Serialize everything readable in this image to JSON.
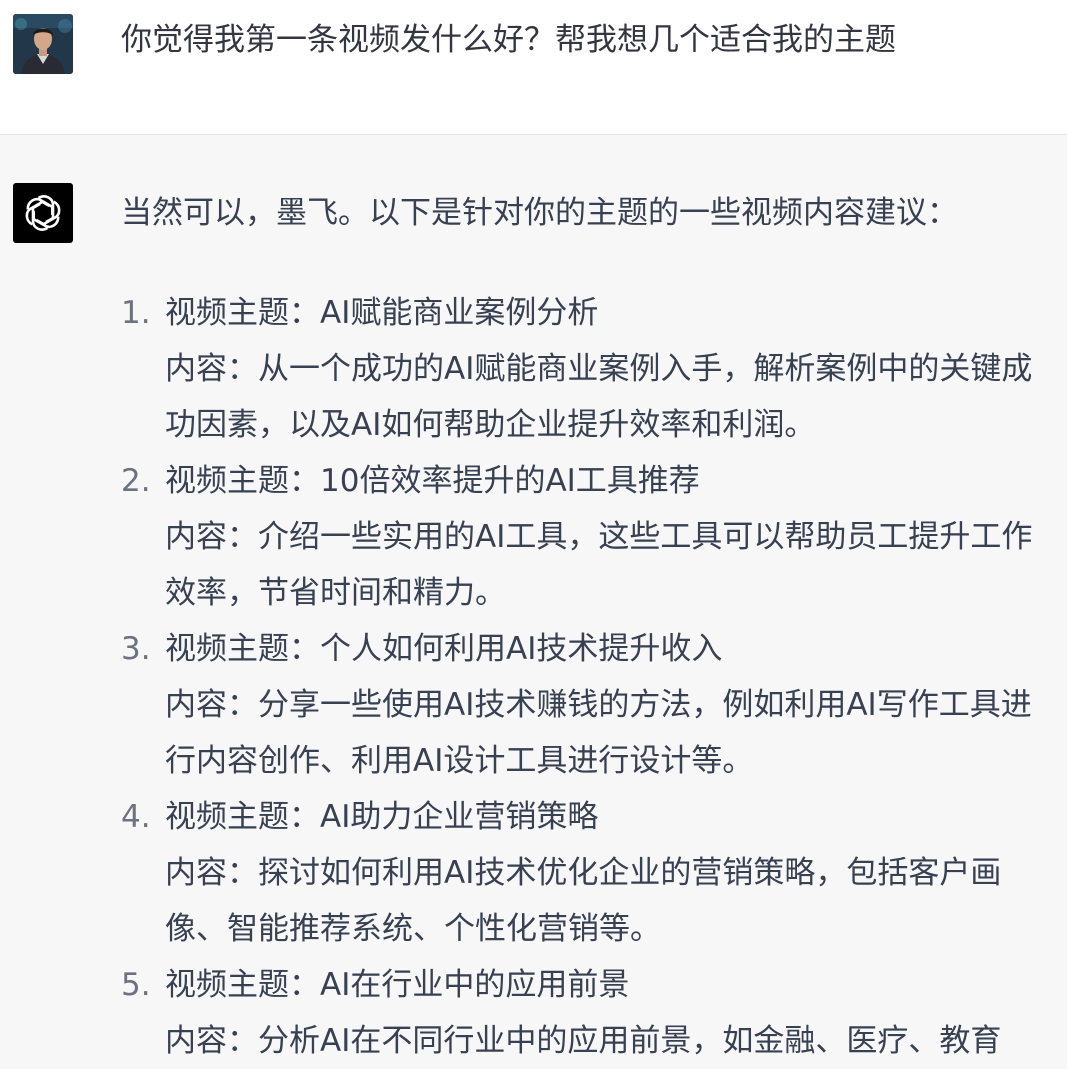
{
  "user": {
    "message": "你觉得我第一条视频发什么好？帮我想几个适合我的主题"
  },
  "assistant": {
    "intro": "当然可以，墨飞。以下是针对你的主题的一些视频内容建议：",
    "items": [
      {
        "number": "1.",
        "title": "视频主题：AI赋能商业案例分析",
        "content": "内容：从一个成功的AI赋能商业案例入手，解析案例中的关键成功因素，以及AI如何帮助企业提升效率和利润。"
      },
      {
        "number": "2.",
        "title": "视频主题：10倍效率提升的AI工具推荐",
        "content": "内容：介绍一些实用的AI工具，这些工具可以帮助员工提升工作效率，节省时间和精力。"
      },
      {
        "number": "3.",
        "title": "视频主题：个人如何利用AI技术提升收入",
        "content": "内容：分享一些使用AI技术赚钱的方法，例如利用AI写作工具进行内容创作、利用AI设计工具进行设计等。"
      },
      {
        "number": "4.",
        "title": "视频主题：AI助力企业营销策略",
        "content": "内容：探讨如何利用AI技术优化企业的营销策略，包括客户画像、智能推荐系统、个性化营销等。"
      },
      {
        "number": "5.",
        "title": "视频主题：AI在行业中的应用前景",
        "content": "内容：分析AI在不同行业中的应用前景，如金融、医疗、教育"
      }
    ]
  },
  "icons": {
    "user_avatar": "user-avatar-photo",
    "assistant_avatar": "openai-logo-icon"
  },
  "colors": {
    "user_bg": "#ffffff",
    "assistant_bg": "#f7f7f8",
    "text": "#374151",
    "logo_bg": "#000000"
  }
}
